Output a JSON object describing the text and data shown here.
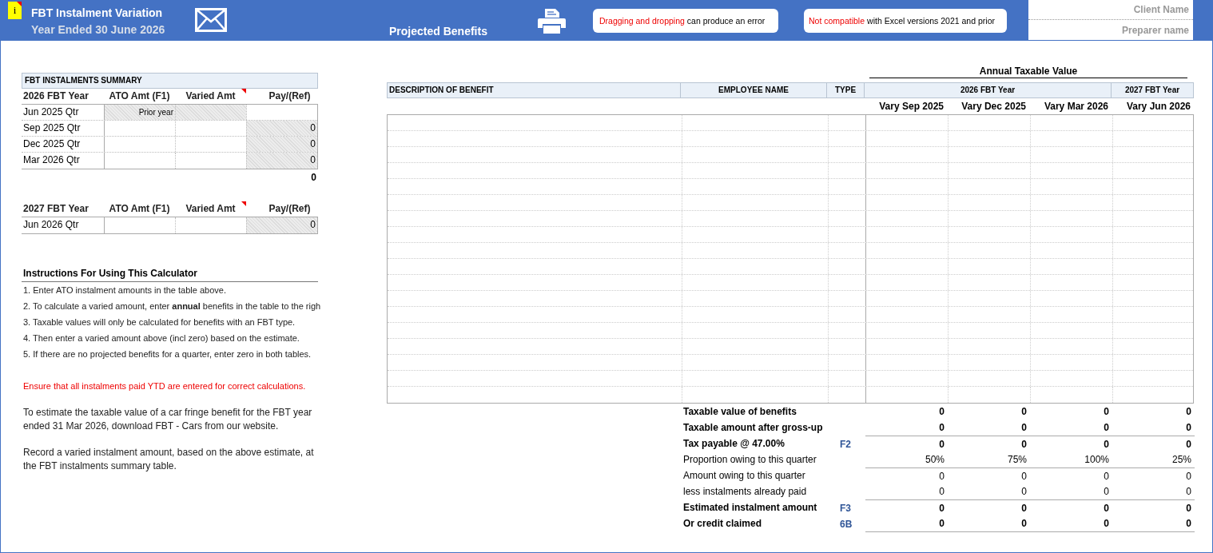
{
  "header": {
    "info_badge": "i",
    "title": "FBT Instalment Variation",
    "subtitle": "Year Ended 30 June 2026",
    "section_title": "Projected Benefits",
    "notices": [
      {
        "highlight": "Dragging and dropping",
        "text": "can produce an error"
      },
      {
        "highlight": "Not compatible",
        "text": "with Excel versions 2021 and prior"
      }
    ],
    "client_fields": [
      {
        "placeholder": "Client Name"
      },
      {
        "placeholder": "Preparer name"
      }
    ]
  },
  "summary": {
    "title": "FBT INSTALMENTS SUMMARY",
    "tables": [
      {
        "columns": [
          "2026 FBT Year",
          "ATO Amt  (F1)",
          "Varied Amt",
          "Pay/(Ref)"
        ],
        "rows": [
          {
            "cells": [
              {
                "text": "Jun 2025 Qtr"
              },
              {
                "text": "Prior year",
                "locked": true
              },
              {
                "text": "",
                "locked": true
              },
              {
                "text": "",
                "locked": false
              }
            ]
          },
          {
            "cells": [
              {
                "text": "Sep 2025 Qtr"
              },
              {
                "text": "",
                "locked": false
              },
              {
                "text": "",
                "locked": false
              },
              {
                "text": "0",
                "locked": true
              }
            ]
          },
          {
            "cells": [
              {
                "text": "Dec 2025 Qtr"
              },
              {
                "text": "",
                "locked": false
              },
              {
                "text": "",
                "locked": false
              },
              {
                "text": "0",
                "locked": true
              }
            ]
          },
          {
            "cells": [
              {
                "text": "Mar 2026 Qtr"
              },
              {
                "text": "",
                "locked": false
              },
              {
                "text": "",
                "locked": false
              },
              {
                "text": "0",
                "locked": true
              }
            ]
          }
        ],
        "total": "0"
      },
      {
        "columns": [
          "2027 FBT Year",
          "ATO Amt  (F1)",
          "Varied Amt",
          "Pay/(Ref)"
        ],
        "rows": [
          {
            "cells": [
              {
                "text": "Jun 2026 Qtr"
              },
              {
                "text": "",
                "locked": false
              },
              {
                "text": "",
                "locked": false
              },
              {
                "text": "0",
                "locked": true
              }
            ]
          }
        ]
      }
    ]
  },
  "instructions": {
    "title": "Instructions For Using This Calculator",
    "steps": [
      "1. Enter ATO instalment amounts in the table above.",
      "2. To calculate a varied amount, enter **annual** benefits in the table to the righ",
      "3. Taxable values will only be calculated for benefits with an FBT type.",
      "4. Then enter a varied amount above (incl zero) based on the estimate.",
      "5. If there are no projected benefits for a quarter, enter zero in both tables."
    ],
    "warning": "Ensure that all instalments paid YTD are entered for correct calculations.",
    "notes": [
      "To estimate the taxable value of a car fringe benefit for the FBT year ended 31 Mar 2026, download FBT - Cars from our website.",
      "Record a varied instalment amount, based on the above estimate, at the FBT instalments summary table."
    ]
  },
  "benefits": {
    "annual_label": "Annual Taxable Value",
    "columns": [
      "DESCRIPTION OF BENEFIT",
      "EMPLOYEE NAME",
      "TYPE"
    ],
    "year_groups": [
      {
        "label": "2026 FBT Year"
      },
      {
        "label": "2027 FBT Year"
      }
    ],
    "quarters": [
      "Vary Sep 2025",
      "Vary Dec 2025",
      "Vary Mar 2026",
      "Vary Jun 2026"
    ],
    "totals": [
      {
        "label": "Taxable value of benefits",
        "bold": true,
        "divider_above": false,
        "values": [
          "0",
          "0",
          "0",
          "0"
        ]
      },
      {
        "label": "Taxable amount after gross-up",
        "bold": true,
        "divider_above": false,
        "values": [
          "0",
          "0",
          "0",
          "0"
        ]
      },
      {
        "label": "Tax payable @ 47.00%",
        "bold": true,
        "code": "F2",
        "divider_above": true,
        "values": [
          "0",
          "0",
          "0",
          "0"
        ]
      },
      {
        "label": "Proportion owing to this quarter",
        "bold": false,
        "divider_above": false,
        "values": [
          "50%",
          "75%",
          "100%",
          "25%"
        ]
      },
      {
        "label": "Amount owing to this quarter",
        "bold": false,
        "divider_above": true,
        "values": [
          "0",
          "0",
          "0",
          "0"
        ]
      },
      {
        "label": "less instalments already paid",
        "bold": false,
        "divider_above": false,
        "values": [
          "0",
          "0",
          "0",
          "0"
        ]
      },
      {
        "label": "Estimated instalment amount",
        "bold": true,
        "code": "F3",
        "divider_above": true,
        "values": [
          "0",
          "0",
          "0",
          "0"
        ]
      },
      {
        "label": "Or credit claimed",
        "bold": true,
        "code": "6B",
        "divider_above": false,
        "values": [
          "0",
          "0",
          "0",
          "0"
        ]
      }
    ]
  }
}
